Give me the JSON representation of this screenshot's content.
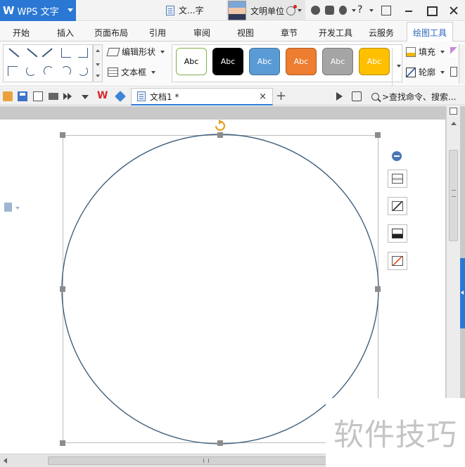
{
  "titlebar": {
    "app_name": "WPS 文字",
    "app_logo": "W",
    "doc_title": "文...字",
    "user_name": "文明单位",
    "help_label": "?"
  },
  "ribbon_tabs": [
    {
      "label": "开始"
    },
    {
      "label": "插入"
    },
    {
      "label": "页面布局"
    },
    {
      "label": "引用"
    },
    {
      "label": "审阅"
    },
    {
      "label": "视图"
    },
    {
      "label": "章节"
    },
    {
      "label": "开发工具"
    },
    {
      "label": "云服务"
    },
    {
      "label": "绘图工具",
      "active": true
    }
  ],
  "ribbon": {
    "edit_shape_label": "编辑形状",
    "textbox_label": "文本框",
    "styles": [
      {
        "label": "Abc",
        "bg": "#ffffff",
        "border": "#7db049",
        "color": "#000000"
      },
      {
        "label": "Abc",
        "bg": "#000000",
        "border": "#000000",
        "color": "#ffffff"
      },
      {
        "label": "Abc",
        "bg": "#5b9bd5",
        "border": "#41719c",
        "color": "#ffffff"
      },
      {
        "label": "Abc",
        "bg": "#ed7d31",
        "border": "#ae5a21",
        "color": "#ffffff"
      },
      {
        "label": "Abc",
        "bg": "#a5a5a5",
        "border": "#787878",
        "color": "#ffffff"
      },
      {
        "label": "Abc",
        "bg": "#ffc000",
        "border": "#bc8c00",
        "color": "#ffffff"
      }
    ],
    "fill_label": "填充",
    "outline_label": "轮廓"
  },
  "quickbar": {
    "doc_tab_label": "文档1 *",
    "doc_tab_close": "×",
    "new_tab": "+",
    "search_placeholder": ">查找命令、搜索..."
  },
  "canvas": {
    "shape": "circle",
    "stroke_color": "#41607d",
    "selection_color": "#8c8c8c",
    "rotate_handle_color": "#e8a020"
  },
  "watermark": "软件技巧",
  "colors": {
    "accent": "#2b78d4",
    "ribbon_active": "#2a65b8"
  }
}
